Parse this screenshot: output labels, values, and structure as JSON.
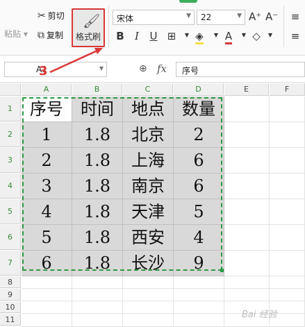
{
  "ribbon": {
    "cut_label": "剪切",
    "copy_label": "复制",
    "paste_label": "粘贴",
    "format_painter_label": "格式刷",
    "font_name": "宋体",
    "font_size": "22",
    "grow_font": "A⁺",
    "shrink_font": "A⁻",
    "bold": "B",
    "italic": "I",
    "underline": "U",
    "font_color_glyph": "A"
  },
  "annotation": {
    "step_label": "3"
  },
  "formula_bar": {
    "cell_ref": "A1",
    "fx_label": "fx",
    "content": "序号"
  },
  "sheet": {
    "columns": [
      "A",
      "B",
      "C",
      "D",
      "E",
      "F"
    ],
    "rows": [
      "1",
      "2",
      "3",
      "4",
      "5",
      "6",
      "7",
      "8",
      "9",
      "10",
      "11"
    ],
    "header_row": [
      "序号",
      "时间",
      "地点",
      "数量"
    ],
    "data_rows": [
      [
        "1",
        "1.8",
        "北京",
        "2"
      ],
      [
        "2",
        "1.8",
        "上海",
        "6"
      ],
      [
        "3",
        "1.8",
        "南京",
        "6"
      ],
      [
        "4",
        "1.8",
        "天津",
        "5"
      ],
      [
        "5",
        "1.8",
        "西安",
        "4"
      ],
      [
        "6",
        "1.8",
        "长沙",
        "9"
      ]
    ]
  },
  "watermark": "Bai 经验",
  "colors": {
    "selection": "#2e9a46",
    "highlight": "#d93636",
    "cell_fill": "#d9d9d9"
  }
}
